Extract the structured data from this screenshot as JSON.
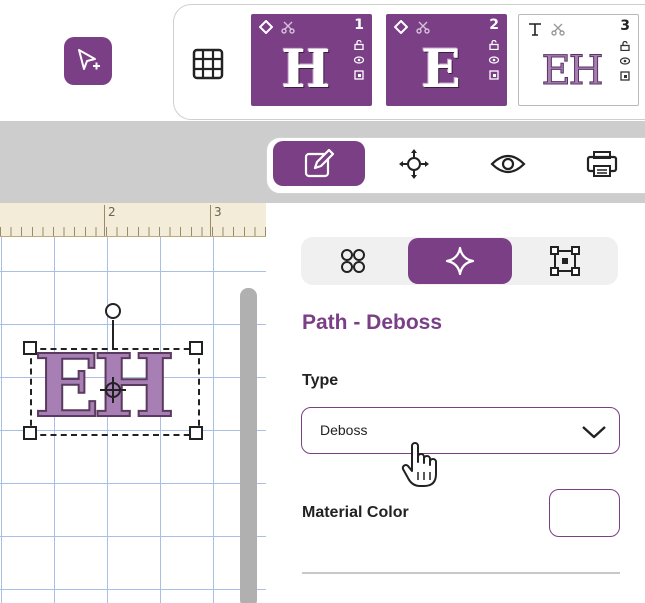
{
  "layers": [
    {
      "number": "1",
      "letter": "H",
      "style": "selected"
    },
    {
      "number": "2",
      "letter": "E",
      "style": "selected"
    },
    {
      "number": "3",
      "letter": "EH",
      "style": "text-group"
    }
  ],
  "ruler": {
    "labels": [
      "2",
      "3"
    ]
  },
  "panel": {
    "title": "Path - Deboss",
    "type_label": "Type",
    "type_value": "Deboss",
    "material_color_label": "Material Color"
  },
  "canvas": {
    "object_text": "EH"
  },
  "colors": {
    "accent": "#7b3f86",
    "object_fill": "#a87fb4"
  }
}
